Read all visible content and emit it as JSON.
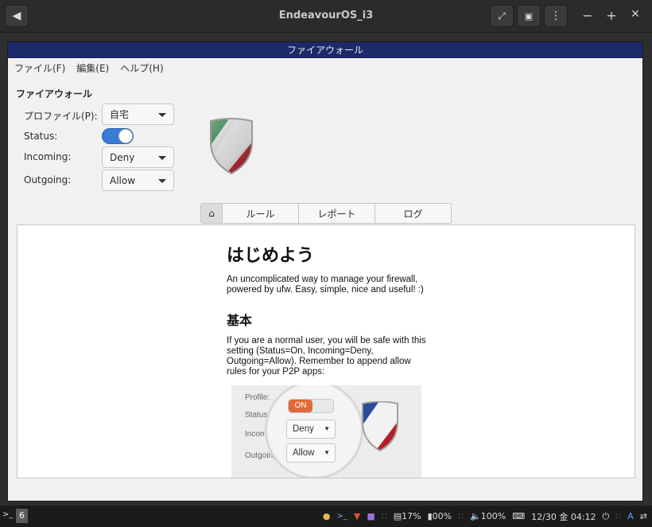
{
  "host_window": {
    "title": "EndeavourOS_i3",
    "back_icon": "arrow-left-icon",
    "controls": [
      "−",
      "+",
      "✕"
    ]
  },
  "app": {
    "title": "ファイアウォール",
    "menu": [
      "ファイル(F)",
      "編集(E)",
      "ヘルプ(H)"
    ],
    "section_title": "ファイアウォール",
    "profile_label": "プロファイル(P):",
    "profile_value": "自宅",
    "status_label": "Status:",
    "status_on": true,
    "incoming_label": "Incoming:",
    "incoming_value": "Deny",
    "outgoing_label": "Outgoing:",
    "outgoing_value": "Allow",
    "tabs": [
      "ルール",
      "レポート",
      "ログ"
    ],
    "accent": "#3a7bd5"
  },
  "content": {
    "title": "はじめよう",
    "intro": "An uncomplicated way to manage your firewall, powered by ufw. Easy, simple, nice and useful! :)",
    "basic_title": "基本",
    "basic_text": "If you are a normal user, you will be safe with this setting (Status=On, Incoming=Deny, Outgoing=Allow). Remember to append allow rules for your P2P apps:",
    "illustration": {
      "profile": "Profile:",
      "status": "Status",
      "incoming": "Incoming:",
      "outgoing": "Outgoing:",
      "on_label": "ON",
      "deny": "Deny",
      "allow": "Allow"
    }
  },
  "taskbar": {
    "prompt": ">_",
    "workspace": "6",
    "mem": "17%",
    "disk": "00%",
    "volume": "100%",
    "datetime": "12/30 金 04:12",
    "lang": "A"
  }
}
